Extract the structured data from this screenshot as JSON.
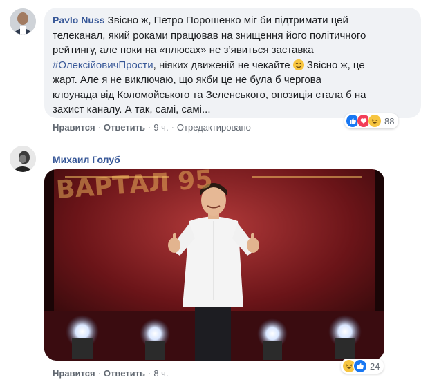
{
  "comments": [
    {
      "author": "Pavlo Nuss",
      "text_lines": [
        "Звісно ж, Петро Порошенко міг би підтримати цей",
        "телеканал, який роками працював на знищення його політичного",
        "рейтингу, але поки на «плюсах» не з’явиться заставка"
      ],
      "hashtag": "#ОлексійовичПрости",
      "line4_mid": ", ніяких движеній не чекайте",
      "line4_end": " Звісно ж, це",
      "text_lines_rest": [
        "жарт. Але я не виключаю, що якби це не була б чергова",
        "клоунада від Коломойського та Зеленського, опозиція стала б на",
        "захист каналу. А так, самі, самі..."
      ],
      "like": "Нравится",
      "reply": "Ответить",
      "time": "9 ч.",
      "edited": "Отредактировано",
      "reactions_count": "88"
    },
    {
      "author": "Михаил Голуб",
      "gif_sign": "ВАРТАЛ 95",
      "like": "Нравится",
      "reply": "Ответить",
      "time": "8 ч.",
      "reactions_count": "24"
    }
  ],
  "colors": {
    "link": "#385898",
    "bubble": "#f0f2f5",
    "like_blue": "#1877f2",
    "love_red": "#f33e58",
    "haha_yellow": "#f7c540"
  }
}
